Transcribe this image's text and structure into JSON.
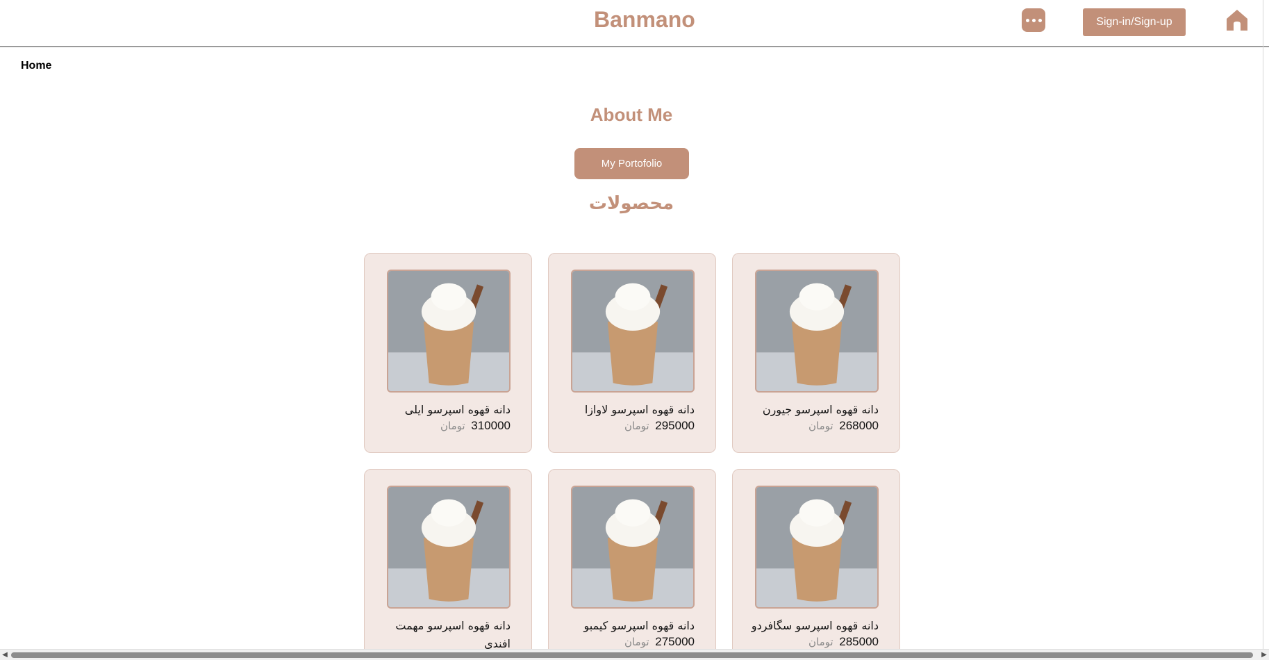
{
  "header": {
    "brand": "Banmano",
    "signin_label": "Sign-in/Sign-up"
  },
  "nav": {
    "home_label": "Home"
  },
  "main": {
    "about_title": "About Me",
    "portfolio_label": "My Portofolio",
    "products_title": "محصولات"
  },
  "products": [
    {
      "name": "دانه قهوه اسپرسو جیورن",
      "price": "268000",
      "currency": "تومان"
    },
    {
      "name": "دانه قهوه اسپرسو لاوازا",
      "price": "295000",
      "currency": "تومان"
    },
    {
      "name": "دانه قهوه اسپرسو ایلی",
      "price": "310000",
      "currency": "تومان"
    },
    {
      "name": "دانه قهوه اسپرسو سگافردو",
      "price": "285000",
      "currency": "تومان"
    },
    {
      "name": "دانه قهوه اسپرسو کیمبو",
      "price": "275000",
      "currency": "تومان"
    },
    {
      "name": "دانه قهوه اسپرسو مهمت افندی",
      "price": "",
      "currency": ""
    }
  ],
  "icons": {
    "more": "more-dots-icon",
    "home": "home-icon"
  },
  "colors": {
    "accent": "#c29079",
    "card_bg": "#f3e8e4"
  }
}
